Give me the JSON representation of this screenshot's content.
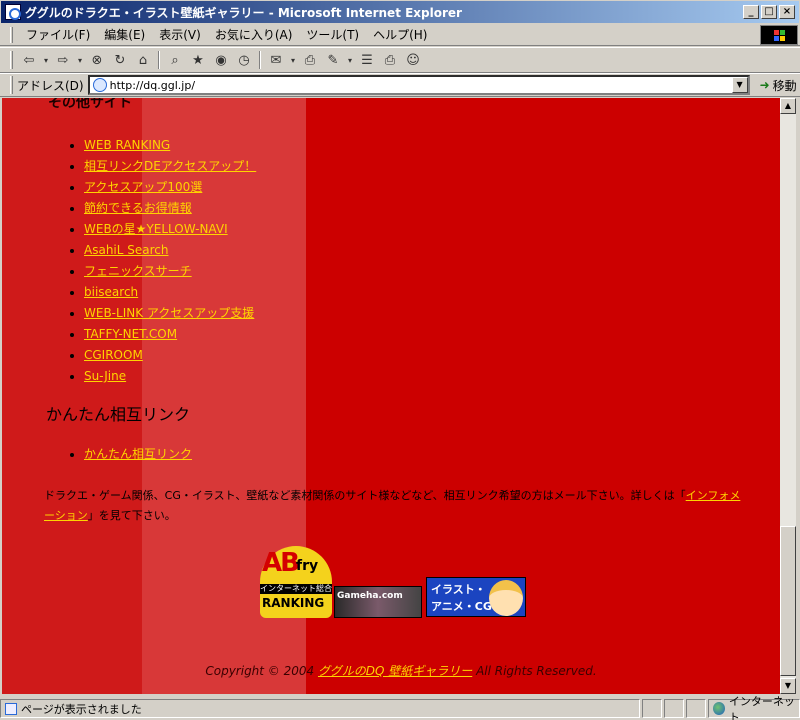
{
  "window": {
    "title": "ググルのドラクエ・イラスト壁紙ギャラリー - Microsoft Internet Explorer",
    "buttons": {
      "minimize": "_",
      "maximize": "□",
      "close": "×"
    }
  },
  "menu": [
    "ファイル(F)",
    "編集(E)",
    "表示(V)",
    "お気に入り(A)",
    "ツール(T)",
    "ヘルプ(H)"
  ],
  "toolbar": {
    "icons": [
      "back-icon",
      "forward-icon",
      "stop-icon",
      "refresh-icon",
      "home-icon",
      "search-icon",
      "favorites-icon",
      "media-icon",
      "history-icon",
      "mail-icon",
      "print-icon",
      "edit-icon",
      "discuss-icon",
      "messenger-icon"
    ],
    "glyphs": {
      "back": "⇦",
      "forward": "⇨",
      "stop": "⊗",
      "refresh": "↻",
      "home": "⌂",
      "search": "⌕",
      "favorites": "★",
      "media": "◉",
      "history": "◷",
      "mail": "✉",
      "print": "⎙",
      "edit": "✎",
      "discuss": "☰",
      "messenger": "☺",
      "dropdown": "▾"
    }
  },
  "address": {
    "label": "アドレス(D)",
    "url": "http://dq.ggl.jp/",
    "go_label": "移動",
    "go_glyph": "➜",
    "dropdown_glyph": "▼"
  },
  "page": {
    "cut_heading": "その他サイト",
    "links": [
      "WEB RANKING",
      "相互リンクDEアクセスアップ！",
      "アクセスアップ100選",
      "節約できるお得情報",
      "WEBの星★YELLOW-NAVI",
      "AsahiL Search",
      "フェニックスサーチ",
      "biisearch",
      "WEB-LINK アクセスアップ支援",
      "TAFFY-NET.COM",
      "CGIROOM",
      "Su-Jine"
    ],
    "section_heading": "かんたん相互リンク",
    "links2": [
      "かんたん相互リンク"
    ],
    "note_text": "ドラクエ・ゲーム関係、CG・イラスト、壁紙など素材関係のサイト様などなど、相互リンク希望の方はメール下さい。詳しくは「",
    "note_link": "インフォメーション",
    "note_tail": "」を見て下さい。",
    "banners": {
      "ab_main": "AB",
      "ab_fry": "fry",
      "ab_sub": "インターネット総合",
      "ab_rank": "RANKING",
      "gm": "Gameha.com",
      "ir_line1": "イラスト・",
      "ir_line2": "アニメ・CG"
    },
    "copyright_prefix": "Copyright © 2004 ",
    "copyright_link": "ググルのDQ 壁紙ギャラリー",
    "copyright_suffix": " All Rights Reserved."
  },
  "scrollbar": {
    "up": "▲",
    "down": "▼"
  },
  "status": {
    "text": "ページが表示されました",
    "zone": "インターネット"
  },
  "colors": {
    "page_bg": "#cc0000",
    "link": "#ffd400",
    "band": "#d83838"
  }
}
